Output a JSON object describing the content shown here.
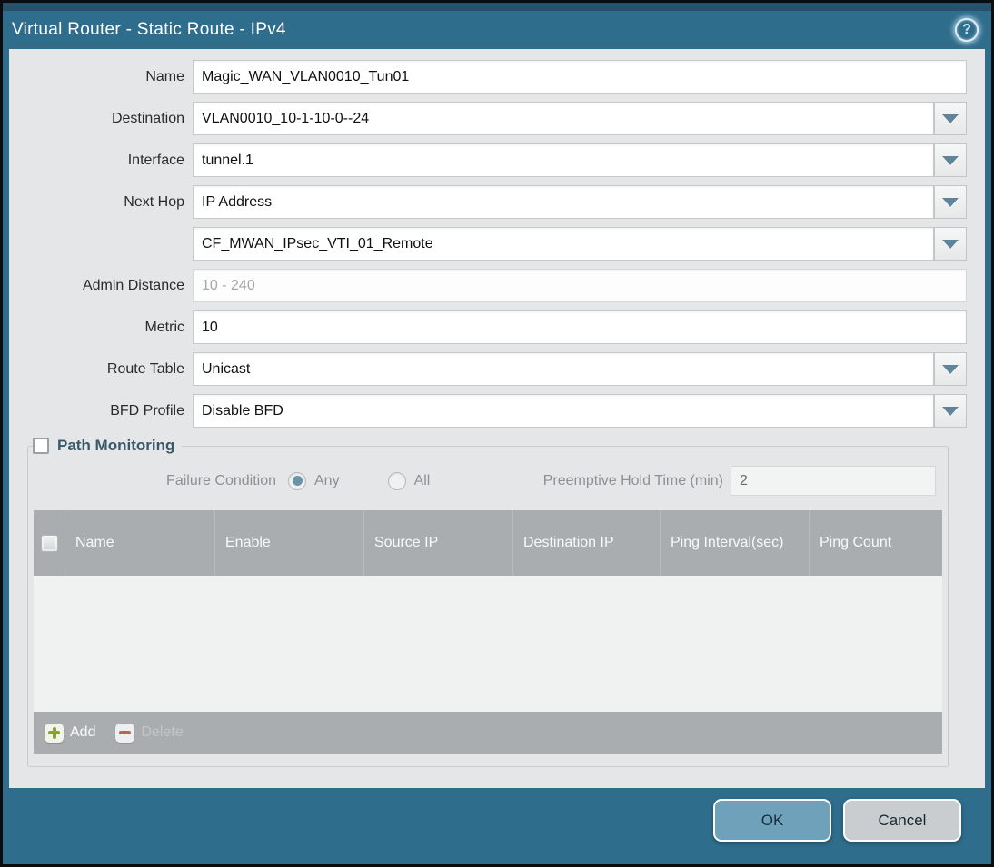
{
  "title": "Virtual Router - Static Route - IPv4",
  "help_icon_glyph": "?",
  "colors": {
    "frame_teal": "#2f6d8c",
    "frame_navy": "#27506a",
    "content_bg": "#e5e6e7",
    "table_header_bg": "#a9adaf",
    "ok_button_bg": "#6fa1bb",
    "add_plus_green": "#85a23a",
    "delete_minus_red": "#ad6a5f",
    "dropdown_arrow": "#5f849b"
  },
  "form": {
    "fields": [
      {
        "label": "Name",
        "value": "Magic_WAN_VLAN0010_Tun01"
      },
      {
        "label": "Destination",
        "value": "VLAN0010_10-1-10-0--24"
      },
      {
        "label": "Interface",
        "value": "tunnel.1"
      },
      {
        "label": "Next Hop",
        "value": "IP Address"
      },
      {
        "label": "",
        "value": "CF_MWAN_IPsec_VTI_01_Remote"
      },
      {
        "label": "Admin Distance",
        "value": "",
        "placeholder": "10 - 240"
      },
      {
        "label": "Metric",
        "value": "10"
      },
      {
        "label": "Route Table",
        "value": "Unicast"
      },
      {
        "label": "BFD Profile",
        "value": "Disable BFD"
      }
    ]
  },
  "path_monitoring": {
    "legend": "Path Monitoring",
    "checkbox_checked": false,
    "failure_condition_label": "Failure Condition",
    "radio_any_label": "Any",
    "radio_all_label": "All",
    "failure_condition_selected": "Any",
    "preemptive_label": "Preemptive Hold Time (min)",
    "preemptive_value": "2",
    "table": {
      "columns": [
        "Name",
        "Enable",
        "Source IP",
        "Destination IP",
        "Ping Interval(sec)",
        "Ping Count"
      ],
      "rows": []
    },
    "add_label": "Add",
    "delete_label": "Delete"
  },
  "footer": {
    "ok_label": "OK",
    "cancel_label": "Cancel"
  }
}
